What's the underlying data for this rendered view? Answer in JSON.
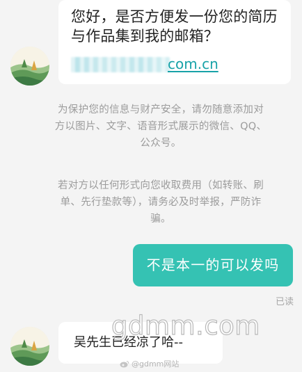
{
  "conversation": {
    "message_1": {
      "lines": [
        "您好，是否方便发一份您的简历",
        "与作品集到我的邮箱？"
      ],
      "email_domain": "com.cn"
    },
    "notices": [
      "为保护您的信息与财产安全，请勿随意添加对方以图片、文字、语音形式展示的微信、QQ、公众号。",
      "若对方以任何形式向您收取费用（如转账、刷单、先行垫款等），请务必及时举报，严防诈骗。"
    ],
    "my_message": "不是本一的可以发吗",
    "read_status": "已读",
    "message_2": "吴先生已经凉了哈--"
  },
  "watermark": {
    "text": "gdmm.com",
    "credit": "@gdmm网站"
  },
  "colors": {
    "background": "#f4f4f4",
    "bubble_other": "#ffffff",
    "bubble_me": "#35c2b3",
    "link": "#18a2a8",
    "notice_text": "#9b9b9b"
  },
  "icons": {
    "avatar": "landscape-avatar",
    "credit": "weibo-icon"
  }
}
